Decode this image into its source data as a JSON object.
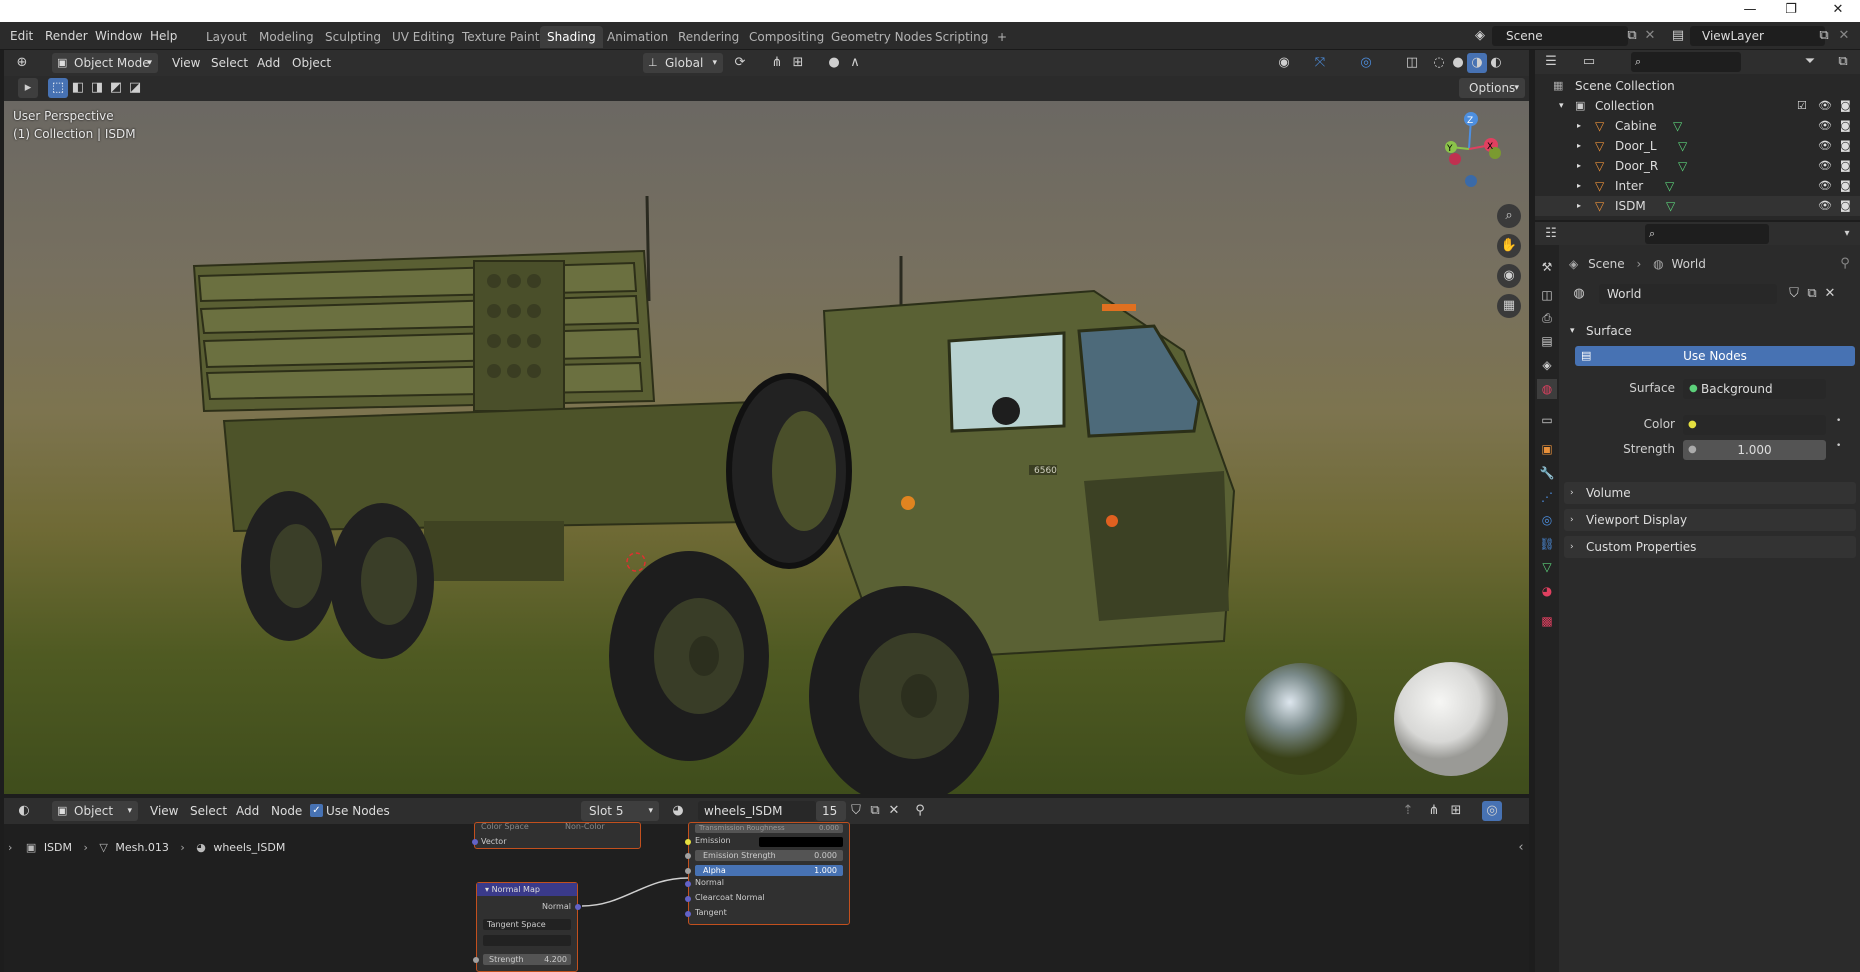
{
  "os": {
    "minimize": "—",
    "restore": "❐",
    "close": "✕"
  },
  "menu": [
    "Edit",
    "Render",
    "Window",
    "Help"
  ],
  "workspaces": [
    "Layout",
    "Modeling",
    "Sculpting",
    "UV Editing",
    "Texture Paint",
    "Shading",
    "Animation",
    "Rendering",
    "Compositing",
    "Geometry Nodes",
    "Scripting",
    "+"
  ],
  "active_workspace": "Shading",
  "scene": {
    "value": "Scene"
  },
  "view_layer": {
    "value": "ViewLayer"
  },
  "viewport_header": {
    "mode": "Object Mode",
    "menus": [
      "View",
      "Select",
      "Add",
      "Object"
    ],
    "orientation": "Global",
    "options": "Options"
  },
  "viewport": {
    "perspective": "User Perspective",
    "collection_info": "(1) Collection | ISDM",
    "truck_plate": "6560",
    "gizmo": {
      "z": "Z",
      "y": "Y",
      "x": "X"
    }
  },
  "outliner": {
    "root": "Scene Collection",
    "collection": "Collection",
    "items": [
      "Cabine",
      "Door_L",
      "Door_R",
      "Inter",
      "ISDM"
    ]
  },
  "properties": {
    "breadcrumb": [
      "Scene",
      "World"
    ],
    "world_name": "World",
    "panel_surface": "Surface",
    "use_nodes": "Use Nodes",
    "surface_label": "Surface",
    "surface_value": "Background",
    "color_label": "Color",
    "strength_label": "Strength",
    "strength_value": "1.000",
    "collapsed_panels": [
      "Volume",
      "Viewport Display",
      "Custom Properties"
    ]
  },
  "node_header": {
    "mode": "Object",
    "menus": [
      "View",
      "Select",
      "Add",
      "Node"
    ],
    "use_nodes": "Use Nodes",
    "slot": "Slot 5",
    "material": "wheels_ISDM",
    "users": "15"
  },
  "node_breadcrumb": [
    "ISDM",
    "Mesh.013",
    "wheels_ISDM"
  ],
  "nodes": {
    "image_tex": {
      "color_space": "Color Space",
      "color_space_value": "Non-Color",
      "vector": "Vector"
    },
    "normal_map": {
      "title": "Normal Map",
      "normal": "Normal",
      "space": "Tangent Space",
      "strength_label": "Strength",
      "strength_value": "4.200"
    },
    "bsdf": {
      "rows": [
        "Transmission Roughness",
        "Emission",
        "Emission Strength",
        "Alpha",
        "Normal",
        "Clearcoat Normal",
        "Tangent"
      ],
      "transmission_roughness": "0.000",
      "emission_strength": "0.000",
      "alpha": "1.000"
    }
  },
  "colors": {
    "accent": "#4772b3",
    "node_border": "#c2501e",
    "active_tab": "#3d3d3d"
  }
}
